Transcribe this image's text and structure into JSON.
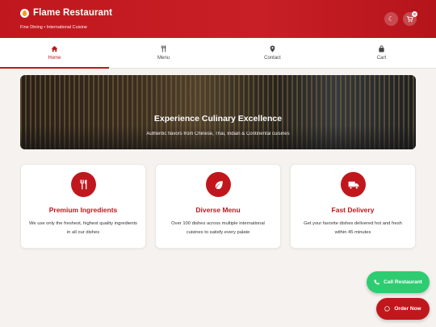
{
  "header": {
    "title": "Flame Restaurant",
    "tagline": "Fine Dining • International Cuisine",
    "cart_count": "0"
  },
  "nav": {
    "items": [
      {
        "label": "Home",
        "icon": "home-icon"
      },
      {
        "label": "Menu",
        "icon": "utensils-icon"
      },
      {
        "label": "Contact",
        "icon": "map-pin-icon"
      },
      {
        "label": "Cart",
        "icon": "bag-icon"
      }
    ],
    "active": "Home"
  },
  "hero": {
    "title": "Experience Culinary Excellence",
    "subtitle": "Authentic flavors from Chinese, Thai, Indian & Continental cuisines"
  },
  "features": [
    {
      "icon": "utensils-icon",
      "title": "Premium Ingredients",
      "text": "We use only the freshest, highest quality ingredients in all our dishes"
    },
    {
      "icon": "leaf-icon",
      "title": "Diverse Menu",
      "text": "Over 100 dishes across multiple international cuisines to satisfy every palate"
    },
    {
      "icon": "truck-icon",
      "title": "Fast Delivery",
      "text": "Get your favorite dishes delivered hot and fresh within 45 minutes"
    }
  ],
  "actions": {
    "call_label": "Call Restaurant",
    "order_label": "Order Now"
  },
  "colors": {
    "brand": "#c0171d",
    "call": "#2ecc71",
    "background": "#f5f2ef"
  }
}
